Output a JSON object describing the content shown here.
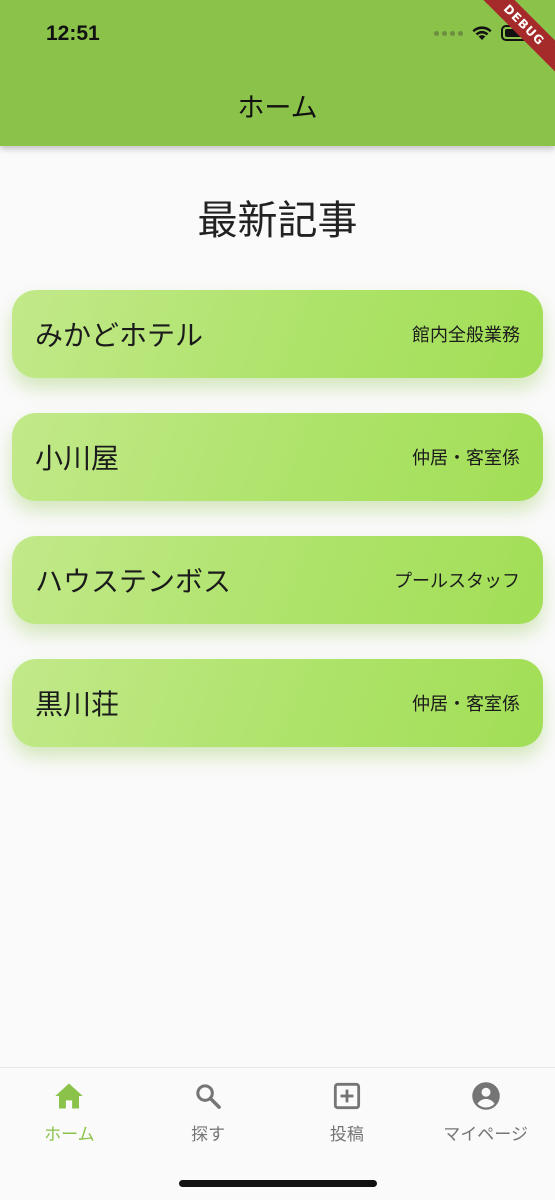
{
  "status": {
    "time": "12:51",
    "debug_label": "DEBUG"
  },
  "appbar": {
    "title": "ホーム"
  },
  "main": {
    "section_title": "最新記事",
    "cards": [
      {
        "name": "みかどホテル",
        "role": "館内全般業務"
      },
      {
        "name": "小川屋",
        "role": "仲居・客室係"
      },
      {
        "name": "ハウステンボス",
        "role": "プールスタッフ"
      },
      {
        "name": "黒川荘",
        "role": "仲居・客室係"
      }
    ]
  },
  "nav": {
    "items": [
      {
        "label": "ホーム",
        "icon": "home-icon",
        "active": true
      },
      {
        "label": "探す",
        "icon": "search-icon",
        "active": false
      },
      {
        "label": "投稿",
        "icon": "add-box-icon",
        "active": false
      },
      {
        "label": "マイページ",
        "icon": "account-circle-icon",
        "active": false
      }
    ]
  },
  "colors": {
    "accent": "#8bc34a",
    "card_start": "#c2e98a",
    "card_end": "#a2de56",
    "inactive": "#757575"
  }
}
